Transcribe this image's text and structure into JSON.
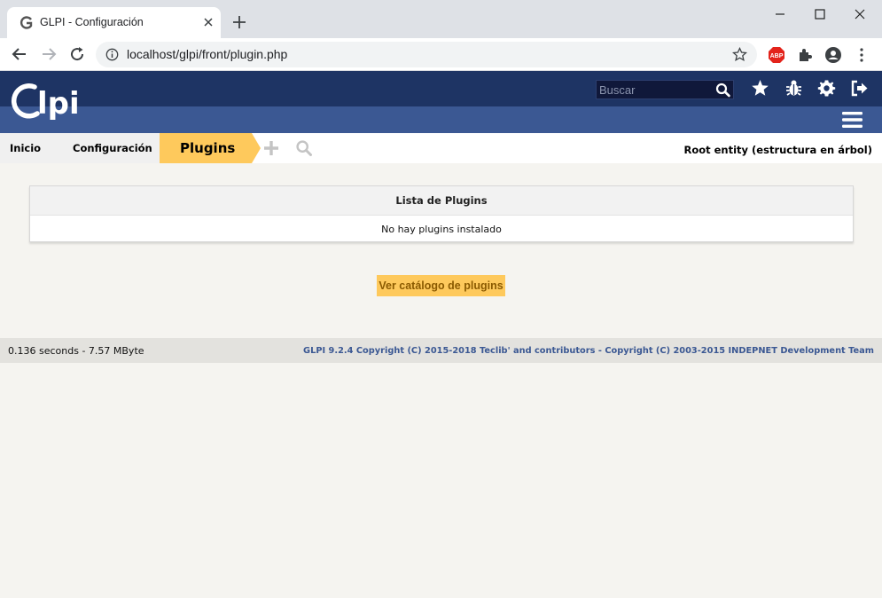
{
  "browser": {
    "tab_title": "GLPI - Configuración",
    "url": "localhost/glpi/front/plugin.php",
    "extension_badge": "ABP"
  },
  "header": {
    "logo_text": "Glpi",
    "search_placeholder": "Buscar",
    "icons": [
      "star-icon",
      "bug-icon",
      "gear-icon",
      "logout-icon"
    ],
    "colors": {
      "top_bar": "#1e3464",
      "sub_bar": "#3b5893",
      "accent": "#fec95c"
    }
  },
  "breadcrumb": {
    "home": "Inicio",
    "config": "Configuración",
    "current": "Plugins",
    "entity": "Root entity (estructura en árbol)"
  },
  "plugins_table": {
    "title": "Lista de Plugins",
    "empty_message": "No hay plugins instalado"
  },
  "catalog_button": "Ver catálogo de plugins",
  "footer": {
    "stats": "0.136 seconds - 7.57 MByte",
    "copyright": "GLPI 9.2.4 Copyright (C) 2015-2018 Teclib' and contributors - Copyright (C) 2003-2015 INDEPNET Development Team"
  }
}
